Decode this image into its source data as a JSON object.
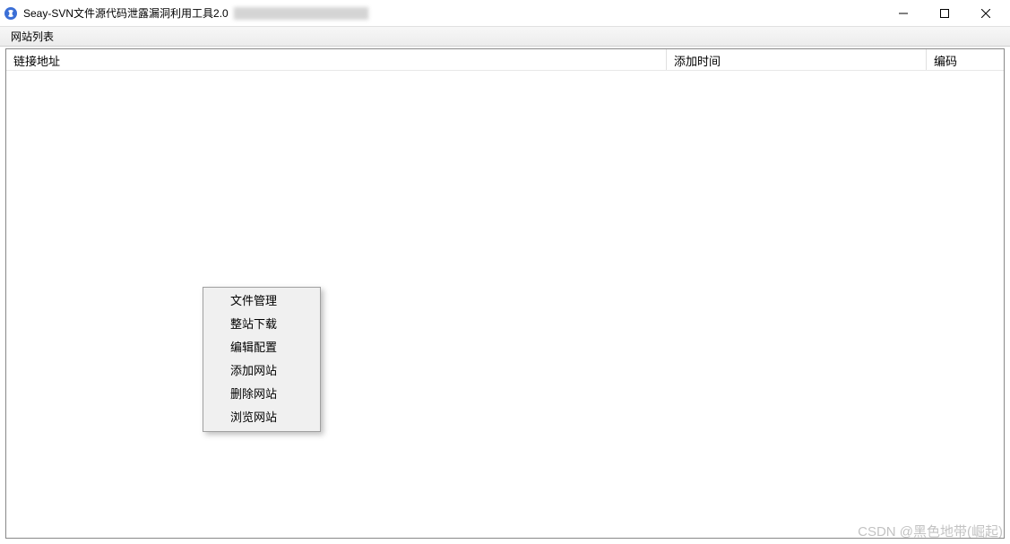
{
  "titlebar": {
    "title": "Seay-SVN文件源代码泄露漏洞利用工具2.0"
  },
  "menubar": {
    "items": [
      {
        "label": "网站列表"
      }
    ]
  },
  "table": {
    "columns": {
      "url": "链接地址",
      "time": "添加时间",
      "encoding": "编码"
    }
  },
  "context_menu": {
    "items": [
      {
        "label": "文件管理"
      },
      {
        "label": "整站下载"
      },
      {
        "label": "编辑配置"
      },
      {
        "label": "添加网站"
      },
      {
        "label": "删除网站"
      },
      {
        "label": "浏览网站"
      }
    ]
  },
  "watermark": "CSDN @黑色地带(崛起)"
}
